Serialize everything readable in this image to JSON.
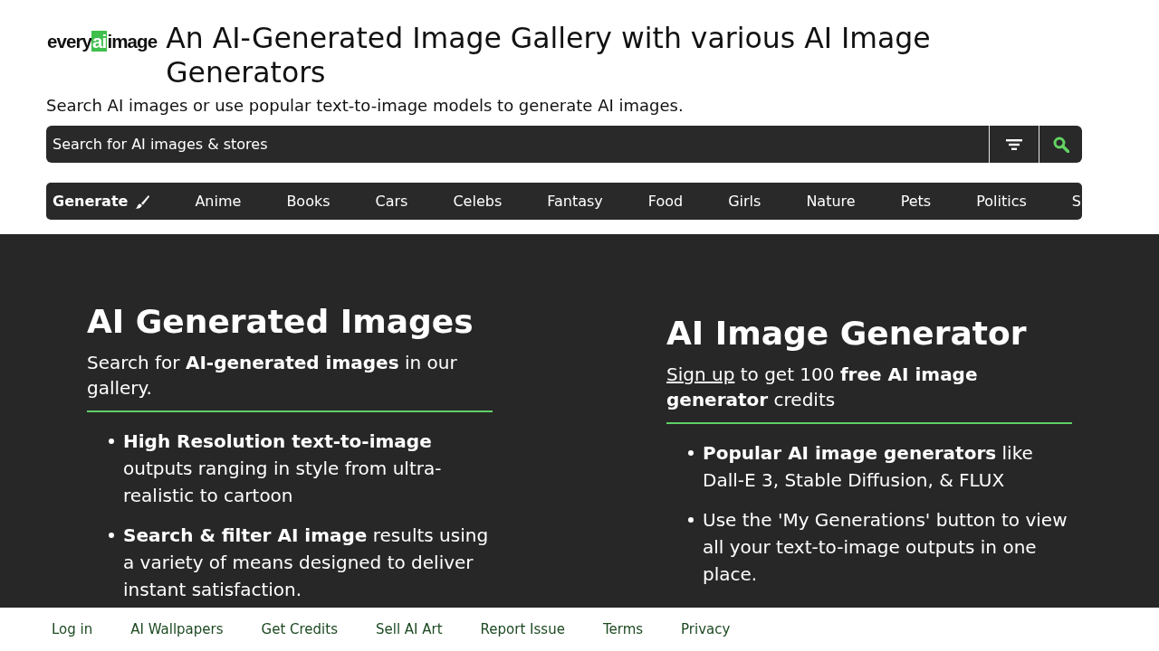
{
  "header": {
    "logo": {
      "prefix": "every",
      "highlight": "ai",
      "suffix": "image"
    },
    "title": "An AI-Generated Image Gallery with various AI Image Generators",
    "subtitle": "Search AI images or use popular text-to-image models to generate AI images."
  },
  "search": {
    "placeholder": "Search for AI images & stores"
  },
  "nav": {
    "generate": "Generate",
    "categories": [
      "Anime",
      "Books",
      "Cars",
      "Celebs",
      "Fantasy",
      "Food",
      "Girls",
      "Nature",
      "Pets",
      "Politics",
      "S"
    ]
  },
  "sections": [
    {
      "heading": "AI Generated Images",
      "description": "Search for **AI-generated images** in our gallery.",
      "bullets": [
        "**High Resolution text-to-image** outputs ranging in style from ultra-realistic to cartoon",
        "**Search & filter AI image** results using a variety of means designed to deliver instant satisfaction."
      ]
    },
    {
      "heading": "AI Image Generator",
      "link": "Sign up",
      "description": "to get 100 **free AI image generator** credits",
      "bullets": [
        "**Popular AI image generators** like Dall-E 3, Stable Diffusion, & FLUX",
        "Use the 'My Generations' button to view all your text-to-image outputs in one place."
      ]
    }
  ],
  "footer": {
    "links": [
      "Log in",
      "AI Wallpapers",
      "Get Credits",
      "Sell AI Art",
      "Report Issue",
      "Terms",
      "Privacy"
    ]
  }
}
